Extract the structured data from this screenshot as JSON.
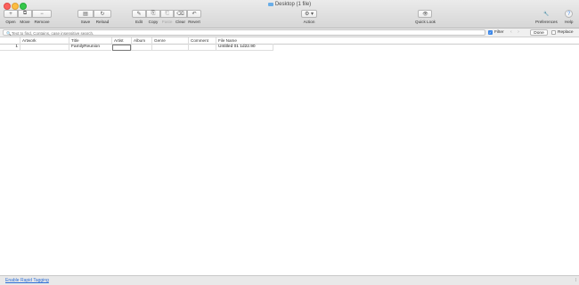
{
  "window": {
    "title": "Desktop (1 file)"
  },
  "toolbar": {
    "open": "Open",
    "move": "Move",
    "remove": "Remove",
    "save": "Save",
    "reload": "Reload",
    "edit": "Edit",
    "copy": "Copy",
    "paste": "Paste",
    "clear": "Clear",
    "revert": "Revert",
    "action": "Action",
    "quick_look": "Quick Look",
    "preferences": "Preferences",
    "help": "Help"
  },
  "icons": {
    "open": "+",
    "move": "⧉",
    "remove": "−",
    "save": "▤",
    "reload": "↻",
    "edit": "✎",
    "copy": "⎘",
    "paste": "⎗",
    "clear": "⌫",
    "revert": "↶",
    "action": "⚙ ▾",
    "quick_look": "👁",
    "preferences": "🔧",
    "help": "?",
    "search": "🔍",
    "check": "✓"
  },
  "search": {
    "placeholder": "Text to find, Contains, case insensitive search.",
    "filter_label": "Filter",
    "done_label": "Done",
    "replace_label": "Replace",
    "prev": "‹",
    "next": "›"
  },
  "table": {
    "columns": [
      "Artwork",
      "Title",
      "Artist",
      "Album",
      "Genre",
      "Comment",
      "File Name"
    ],
    "rows": [
      {
        "index": "1",
        "artwork": "",
        "title": "FamilyReunion",
        "artist": "",
        "album": "",
        "genre": "",
        "comment": "",
        "file_name": "Untitled 01 1d22.90"
      }
    ]
  },
  "status": {
    "link": "Enable Rapid Tagging",
    "resize_glyph": "⁞"
  }
}
